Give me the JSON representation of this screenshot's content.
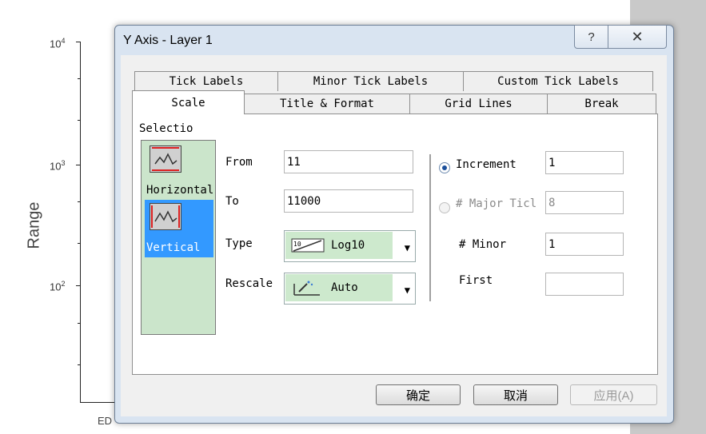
{
  "background_plot": {
    "y_labels": [
      {
        "base": "10",
        "exp": "4"
      },
      {
        "base": "10",
        "exp": "3"
      },
      {
        "base": "10",
        "exp": "2"
      }
    ],
    "y_axis_title": "Range",
    "x_category_first": "ED"
  },
  "dialog": {
    "title": "Y Axis - Layer 1",
    "help_glyph": "?",
    "close_glyph": "✕",
    "tabs_back": [
      "Tick Labels",
      "Minor Tick Labels",
      "Custom Tick Labels"
    ],
    "tabs_front": [
      "Scale",
      "Title & Format",
      "Grid Lines",
      "Break"
    ],
    "selection": {
      "label": "Selectio",
      "items": [
        {
          "label": "Horizontal",
          "selected": false
        },
        {
          "label": "Vertical",
          "selected": true
        }
      ]
    },
    "from": {
      "label": "From",
      "value": "11"
    },
    "to": {
      "label": "To",
      "value": "11000"
    },
    "type": {
      "label": "Type",
      "value": "Log10",
      "icon_text": "10"
    },
    "rescale": {
      "label": "Rescale",
      "value": "Auto"
    },
    "increment": {
      "label": "Increment",
      "value": "1",
      "selected": true
    },
    "major_ticks": {
      "label": "# Major Ticl",
      "value": "8",
      "enabled": false
    },
    "minor": {
      "label": "# Minor",
      "value": "1"
    },
    "first": {
      "label": "First",
      "value": ""
    },
    "buttons": {
      "ok": "确定",
      "cancel": "取消",
      "apply": "应用(A)"
    }
  },
  "colors": {
    "panel_green": "#cbe5cb",
    "selection_blue": "#3399ff",
    "dialog_frame": "#d9e4f1"
  }
}
